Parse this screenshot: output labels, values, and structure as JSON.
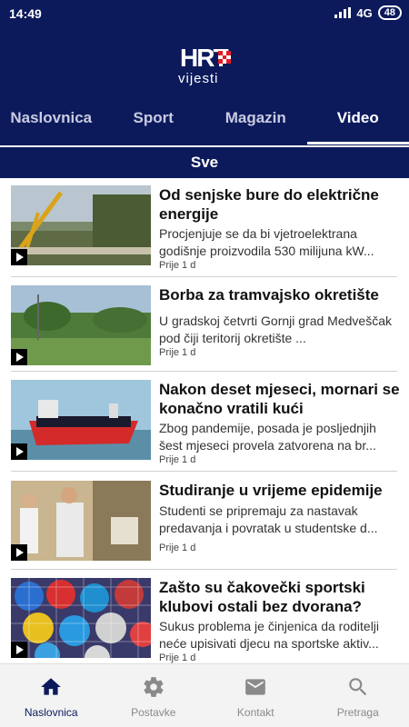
{
  "status": {
    "time": "14:49",
    "network": "4G",
    "battery": "48"
  },
  "logo": {
    "brand": "HRT",
    "sub": "vijesti"
  },
  "tabs": [
    "Naslovnica",
    "Sport",
    "Magazin",
    "Video"
  ],
  "active_tab": "Video",
  "filter": "Sve",
  "articles": [
    {
      "title": "Od senjske bure do električne energije",
      "desc": "Procjenjuje se da bi vjetroelektrana godišnje proizvodila 530 milijuna kW...",
      "time": "Prije 1 d"
    },
    {
      "title": "Borba za tramvajsko okretište",
      "desc": "U gradskoj četvrti Gornji grad Medveščak pod čiji teritorij okretište ...",
      "time": "Prije 1 d"
    },
    {
      "title": "Nakon deset mjeseci, mornari se konačno vratili kući",
      "desc": "Zbog pandemije, posada je posljednjih šest mjeseci provela zatvorena na br...",
      "time": "Prije 1 d"
    },
    {
      "title": "Studiranje u vrijeme epidemije",
      "desc": "Studenti se pripremaju za nastavak predavanja i povratak u studentske d...",
      "time": "Prije 1 d"
    },
    {
      "title": "Zašto su čakovečki sportski klubovi ostali bez dvorana?",
      "desc": "Sukus problema je činjenica da roditelji neće upisivati djecu na sportske aktiv...",
      "time": "Prije 1 d"
    }
  ],
  "bottom_nav": [
    {
      "label": "Naslovnica",
      "icon": "home-icon",
      "active": true
    },
    {
      "label": "Postavke",
      "icon": "gear-icon",
      "active": false
    },
    {
      "label": "Kontakt",
      "icon": "mail-icon",
      "active": false
    },
    {
      "label": "Pretraga",
      "icon": "search-icon",
      "active": false
    }
  ],
  "colors": {
    "brand_navy": "#0c1a5c",
    "logo_red": "#e31b23"
  }
}
